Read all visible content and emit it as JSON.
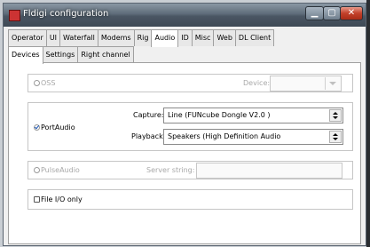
{
  "window": {
    "title": "Fldigi configuration",
    "min_glyph": "▁",
    "max_glyph": "▢",
    "close_glyph": "✕"
  },
  "main_tabs": [
    "Operator",
    "UI",
    "Waterfall",
    "Modems",
    "Rig",
    "Audio",
    "ID",
    "Misc",
    "Web",
    "DL Client"
  ],
  "active_main_tab": "Audio",
  "sub_tabs": [
    "Devices",
    "Settings",
    "Right channel"
  ],
  "active_sub_tab": "Devices",
  "oss": {
    "label": "OSS",
    "checked": false,
    "enabled": false,
    "device_label": "Device:",
    "device_value": ""
  },
  "portaudio": {
    "label": "PortAudio",
    "checked": true,
    "capture_label": "Capture:",
    "capture_value": "Line (FUNcube Dongle V2.0  )",
    "playback_label": "Playback:",
    "playback_value": "Speakers (High Definition Audio"
  },
  "pulseaudio": {
    "label": "PulseAudio",
    "checked": false,
    "enabled": false,
    "server_label": "Server string:",
    "server_value": ""
  },
  "fileio": {
    "label": "File I/O only",
    "checked": false
  }
}
